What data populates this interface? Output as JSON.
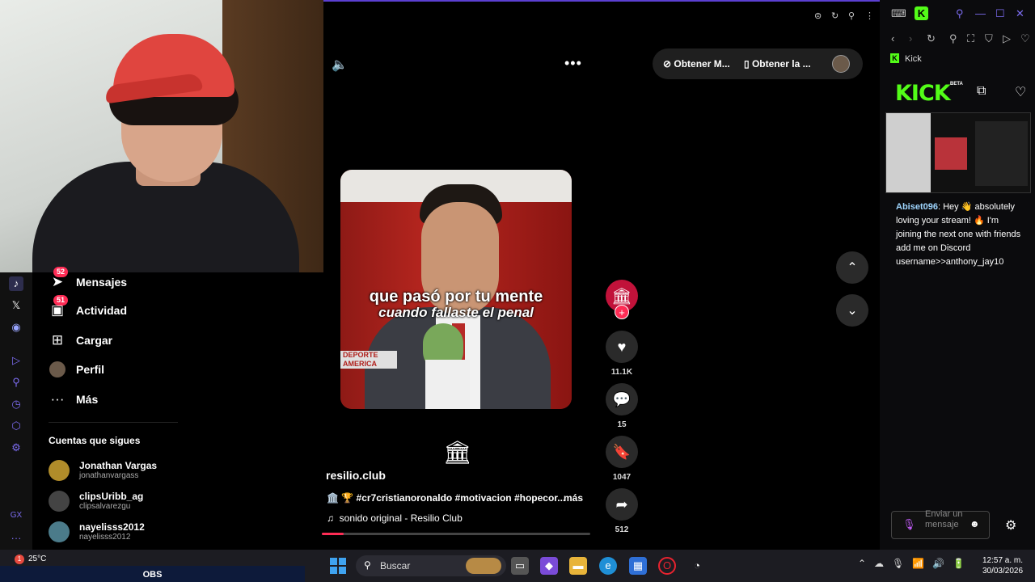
{
  "tiktok": {
    "nav": [
      {
        "label": "Mensajes",
        "badge": "52"
      },
      {
        "label": "Actividad",
        "badge": "51"
      },
      {
        "label": "Cargar"
      },
      {
        "label": "Perfil"
      },
      {
        "label": "Más"
      }
    ],
    "following_title": "Cuentas que sigues",
    "following": [
      {
        "name": "Jonathan Vargas",
        "user": "jonathanvargass"
      },
      {
        "name": "clipsUribb_ag",
        "user": "clipsalvarezgu"
      },
      {
        "name": "nayelisss2012",
        "user": "nayelisss2012"
      }
    ],
    "get_app_label": "Obtener M...",
    "get_app2_label": "Obtener la ...",
    "caption_line1": "que pasó por tu mente",
    "caption_line2": "cuando fallaste el penal",
    "video_logo": "DEPORTE AMERICA",
    "creator": "resilio.club",
    "description": "🏛️ 🏆 #cr7cristianoronaldo #motivacion #hopecor...",
    "more": "más",
    "sound": "sonido original - Resilio Club",
    "likes": "11.1K",
    "comments": "15",
    "saves": "1047",
    "shares": "512",
    "progress_percent": 8
  },
  "kick": {
    "tab_label": "Kick",
    "logo": "KICK",
    "beta": "BETA",
    "chat": {
      "user": "Abiset096",
      "message": ": Hey 👋 absolutely loving your stream! 🔥 I'm joining the next one with friends add me on Discord username>>anthony_jay10"
    },
    "input_placeholder": "Enviar un mensaje"
  },
  "taskbar": {
    "obs": "OBS",
    "temperature": "25°C",
    "weather_badge": "1",
    "search_placeholder": "Buscar",
    "time": "12:57 a. m.",
    "date": "30/03/2026"
  },
  "colors": {
    "accent": "#fe2c55",
    "kick_green": "#53fc18",
    "browser_accent": "#5b3fd1"
  }
}
